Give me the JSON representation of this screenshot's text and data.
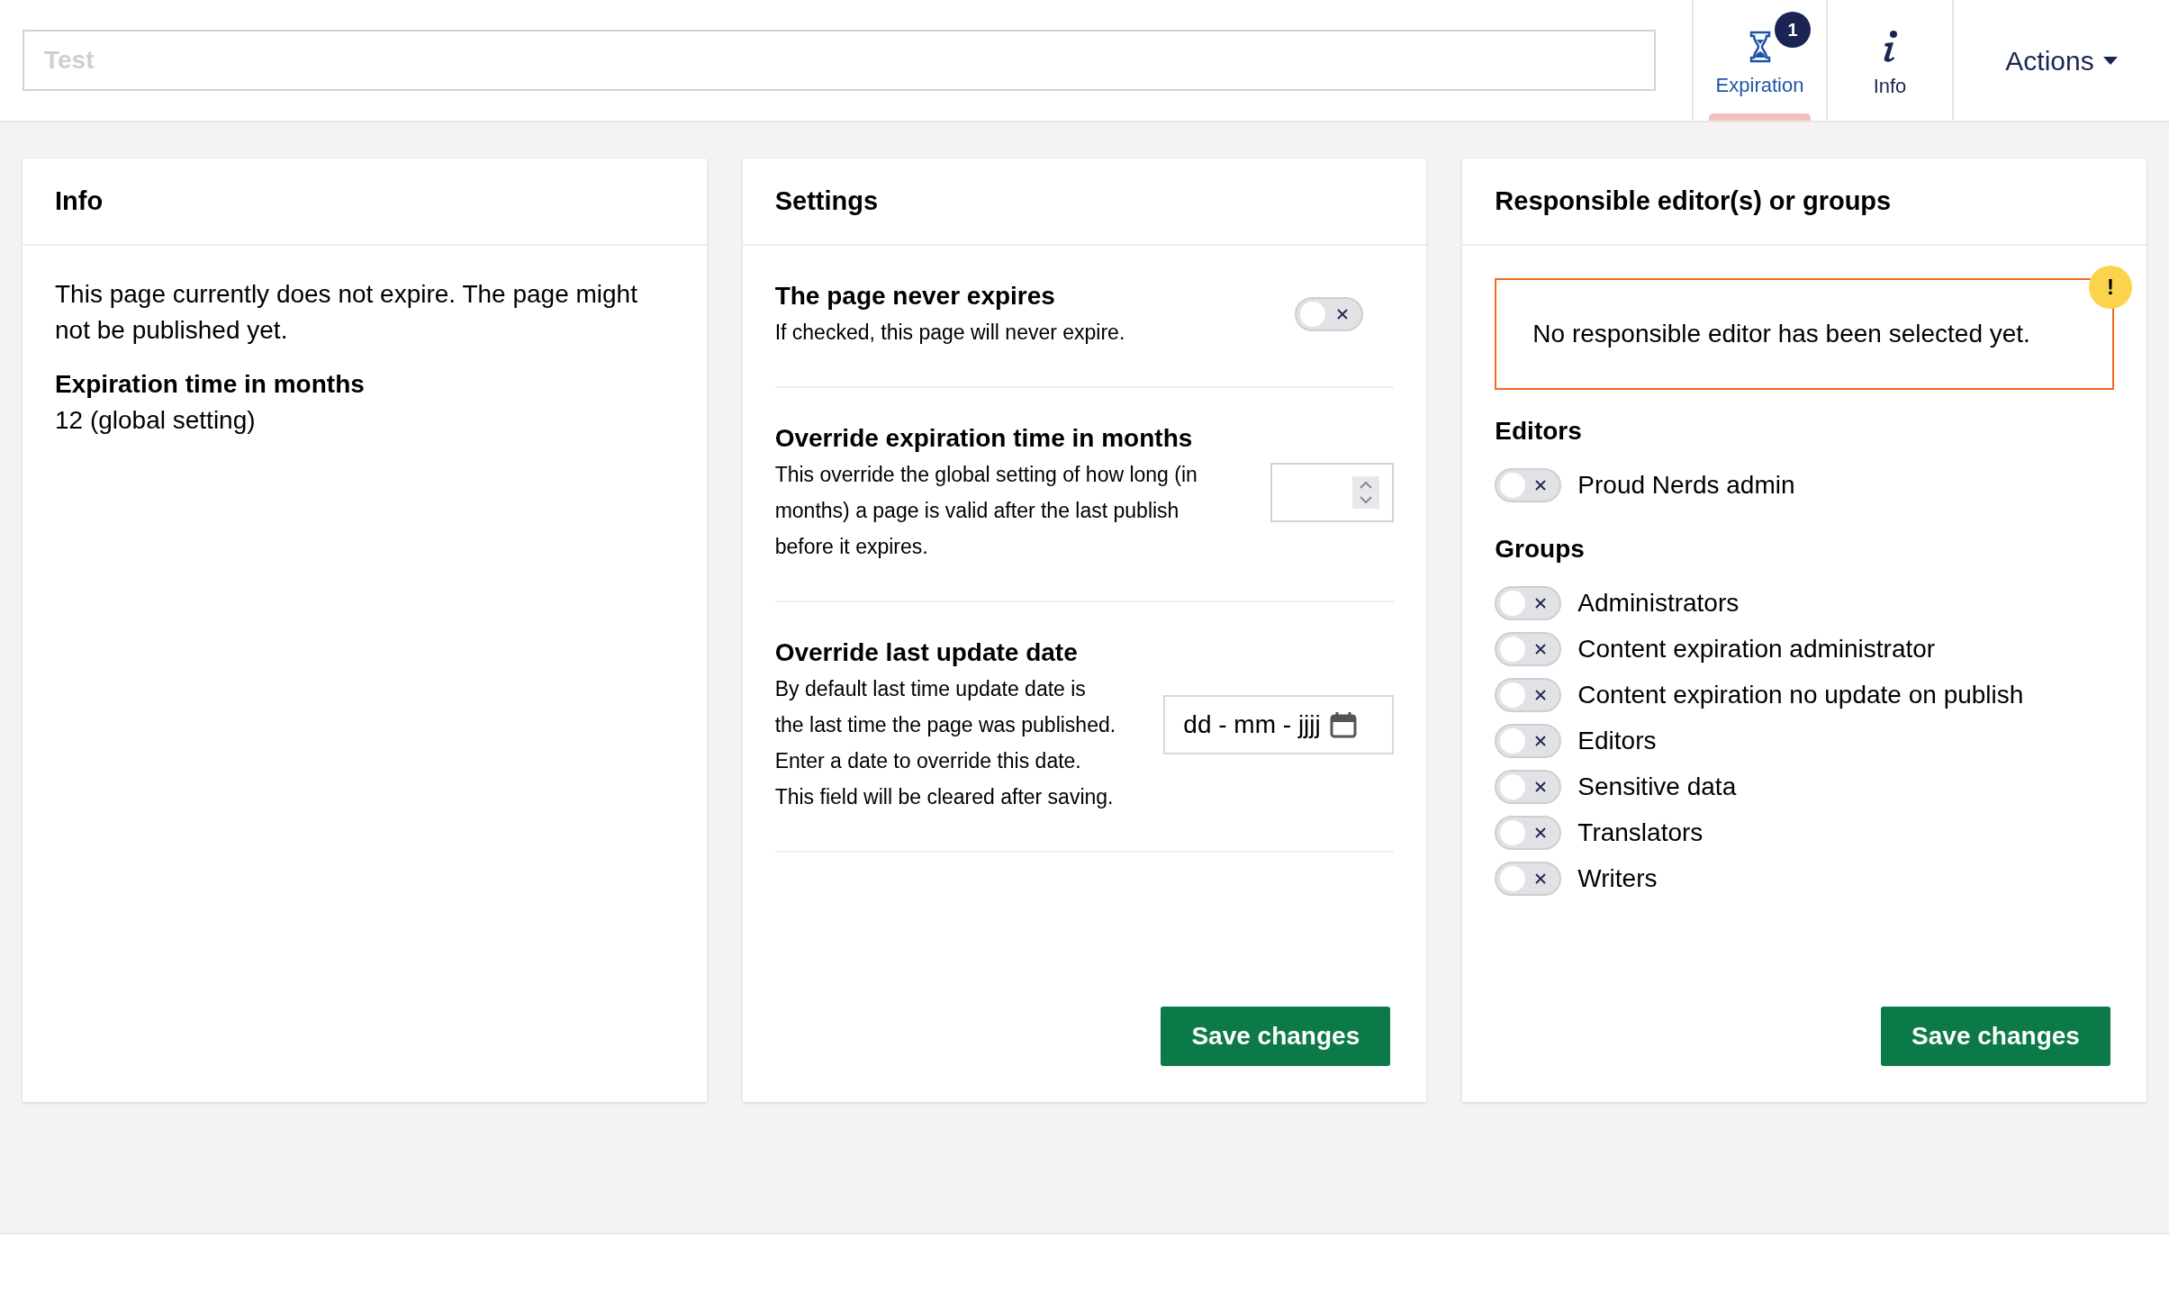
{
  "header": {
    "title_field": {
      "value": "Test",
      "disabled": true
    },
    "tabs": [
      {
        "label": "Expiration",
        "selected": true,
        "badge": "1"
      },
      {
        "label": "Info",
        "selected": false
      }
    ],
    "actions": {
      "label": "Actions"
    }
  },
  "info_card": {
    "title": "Info",
    "text": "This page currently does not expire. The page might not be published yet.",
    "fields": [
      {
        "label": "Expiration time in months",
        "value": "12 (global setting)"
      }
    ]
  },
  "settings_card": {
    "title": "Settings",
    "rows": [
      {
        "kind": "toggle",
        "title": "The page never expires",
        "description": "If checked, this page will never expire.",
        "on": false
      },
      {
        "kind": "number",
        "title": "Override expiration time in months",
        "description": "This override the global setting of how long (in months) a page is valid after the last publish before it expires."
      },
      {
        "kind": "date",
        "title": "Override last update date",
        "description": "By default last time update date is the last time the page was published. Enter a date to override this date. This field will be cleared after saving.",
        "placeholder": "dd - mm - jjjj"
      }
    ],
    "save_button": "Save changes"
  },
  "editors_card": {
    "title": "Responsible editor(s) or groups",
    "warning": "No responsible editor has been selected yet.",
    "warning_mark": "!",
    "sections": [
      {
        "heading": "Editors",
        "items": [
          {
            "label": "Proud Nerds admin",
            "on": false
          }
        ]
      },
      {
        "heading": "Groups",
        "items": [
          {
            "label": "Administrators",
            "on": false
          },
          {
            "label": "Content expiration administrator",
            "on": false
          },
          {
            "label": "Content expiration no update on publish",
            "on": false
          },
          {
            "label": "Editors",
            "on": false
          },
          {
            "label": "Sensitive data",
            "on": false
          },
          {
            "label": "Translators",
            "on": false
          },
          {
            "label": "Writers",
            "on": false
          }
        ]
      }
    ],
    "save_button": "Save changes"
  }
}
